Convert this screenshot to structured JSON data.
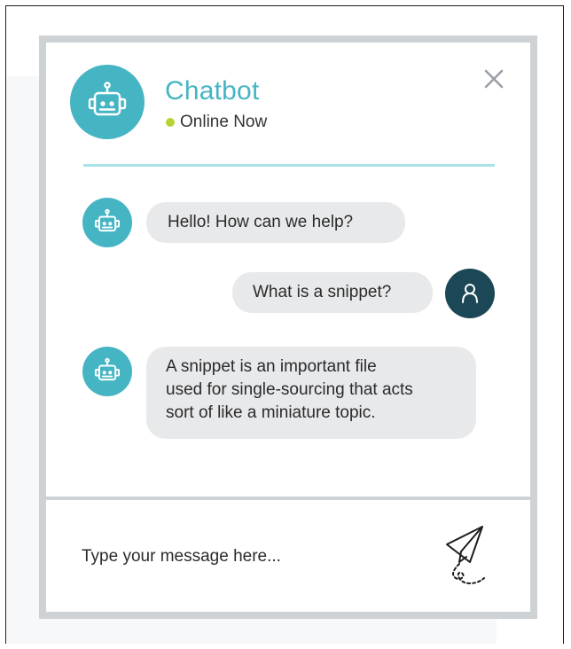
{
  "header": {
    "title": "Chatbot",
    "status": "Online Now",
    "status_color": "#b5d334",
    "avatar_icon": "robot-icon",
    "close_icon": "close-icon"
  },
  "messages": [
    {
      "sender": "bot",
      "text": "Hello! How can we help?"
    },
    {
      "sender": "user",
      "text": "What is a snippet?"
    },
    {
      "sender": "bot",
      "lines": [
        "A snippet is an important file",
        "used for single-sourcing that acts",
        "sort of like a miniature topic."
      ]
    }
  ],
  "composer": {
    "placeholder": "Type your message here...",
    "send_icon": "paper-plane-icon"
  },
  "colors": {
    "accent": "#45b5c4",
    "user_avatar": "#1b4757",
    "bubble": "#e8e9eb",
    "frame": "#ced2d5",
    "divider": "#a9e3ea"
  }
}
